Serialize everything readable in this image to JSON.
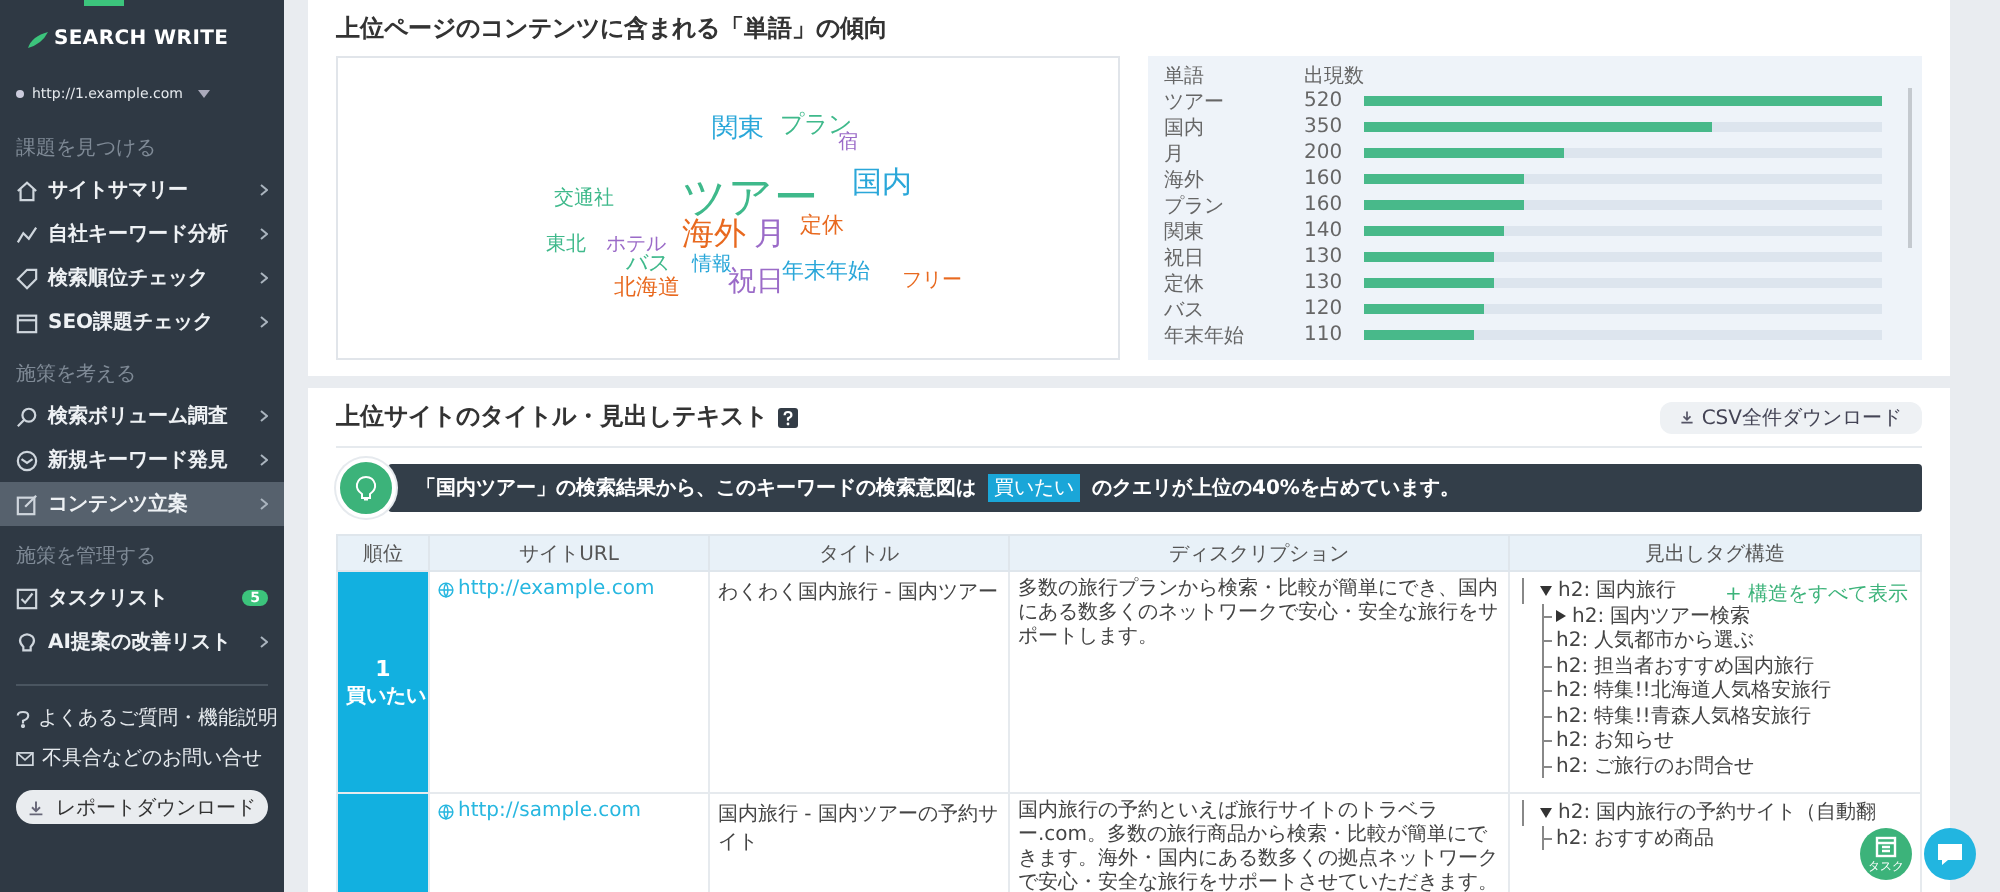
{
  "sidebar": {
    "logo": "SEARCH WRITE",
    "site": "http://1.example.com",
    "sections": [
      {
        "label": "課題を見つける",
        "items": [
          {
            "label": "サイトサマリー",
            "selected": false
          },
          {
            "label": "自社キーワード分析",
            "selected": false
          },
          {
            "label": "検索順位チェック",
            "selected": false
          },
          {
            "label": "SEO課題チェック",
            "selected": false
          }
        ]
      },
      {
        "label": "施策を考える",
        "items": [
          {
            "label": "検索ボリューム調査",
            "selected": false
          },
          {
            "label": "新規キーワード発見",
            "selected": false
          },
          {
            "label": "コンテンツ立案",
            "selected": true
          }
        ]
      },
      {
        "label": "施策を管理する",
        "items": [
          {
            "label": "タスクリスト",
            "selected": false,
            "badge": "5"
          },
          {
            "label": "AI提案の改善リスト",
            "selected": false
          }
        ]
      }
    ],
    "links": [
      "よくあるご質問・機能説明",
      "不具合などのお問い合せ"
    ],
    "report_button": "レポートダウンロード"
  },
  "word_section": {
    "title": "上位ページのコンテンツに含まれる「単語」の傾向",
    "words": [
      {
        "text": "関東",
        "color": "#2aa7d9"
      },
      {
        "text": "プラン",
        "color": "#3fb98b"
      },
      {
        "text": "宿",
        "color": "#9b6bc8"
      },
      {
        "text": "交通社",
        "color": "#3fb98b"
      },
      {
        "text": "ツアー",
        "color": "#3fb98b"
      },
      {
        "text": "国内",
        "color": "#2aa7d9"
      },
      {
        "text": "東北",
        "color": "#3fb98b"
      },
      {
        "text": "ホテル",
        "color": "#9b6bc8"
      },
      {
        "text": "海外",
        "color": "#e8691f"
      },
      {
        "text": "月",
        "color": "#9b6bc8"
      },
      {
        "text": "定休",
        "color": "#e8691f"
      },
      {
        "text": "バス",
        "color": "#3fb98b"
      },
      {
        "text": "情報",
        "color": "#2aa7d9"
      },
      {
        "text": "年末年始",
        "color": "#2aa7d9"
      },
      {
        "text": "北海道",
        "color": "#e8691f"
      },
      {
        "text": "祝日",
        "color": "#9b6bc8"
      },
      {
        "text": "フリー",
        "color": "#e8691f"
      }
    ],
    "frequency_table": {
      "columns": [
        "単語",
        "出現数"
      ],
      "rows": [
        {
          "word": "ツアー",
          "count": "520",
          "level": 1
        },
        {
          "word": "国内",
          "count": "350",
          "level": 0.673
        },
        {
          "word": "月",
          "count": "200",
          "level": 0.385
        },
        {
          "word": "海外",
          "count": "160",
          "level": 0.308
        },
        {
          "word": "プラン",
          "count": "160",
          "level": 0.308
        },
        {
          "word": "関東",
          "count": "140",
          "level": 0.269
        },
        {
          "word": "祝日",
          "count": "130",
          "level": 0.25
        },
        {
          "word": "定休",
          "count": "130",
          "level": 0.25
        },
        {
          "word": "バス",
          "count": "120",
          "level": 0.231
        },
        {
          "word": "年末年始",
          "count": "110",
          "level": 0.212
        }
      ]
    }
  },
  "headings_section": {
    "title": "上位サイトのタイトル・見出しテキスト",
    "csv_button": "CSV全件ダウンロード",
    "insight": {
      "before": "「国内ツアー」の検索結果から、このキーワードの検索意図は",
      "tag": "買いたい",
      "after": "のクエリが上位の40%を占めています。"
    },
    "table": {
      "columns": [
        "順位",
        "サイトURL",
        "タイトル",
        "ディスクリプション",
        "見出しタグ構造"
      ],
      "rows": [
        {
          "rank": "1",
          "intent": "買いたい",
          "url": "http://example.com",
          "title": "わくわく国内旅行 - 国内ツアー",
          "description": "多数の旅行プランから検索・比較が簡単にでき、国内にある数多くのネットワークで安心・安全な旅行をサポートします。",
          "show_all": "+ 構造をすべて表示",
          "headings": [
            {
              "text": "h2: 国内旅行",
              "kind": "group",
              "expanded": true,
              "children": [
                {
                  "text": "h2: 国内ツアー検索",
                  "kind": "group",
                  "expanded": false
                },
                {
                  "text": "h2: 人気都市から選ぶ",
                  "kind": "leaf"
                },
                {
                  "text": "h2: 担当者おすすめ国内旅行",
                  "kind": "leaf"
                },
                {
                  "text": "h2: 特集!!北海道人気格安旅行",
                  "kind": "leaf"
                },
                {
                  "text": "h2: 特集!!青森人気格安旅行",
                  "kind": "leaf"
                },
                {
                  "text": "h2: お知らせ",
                  "kind": "leaf"
                },
                {
                  "text": "h2: ご旅行のお問合せ",
                  "kind": "leaf"
                }
              ]
            }
          ]
        },
        {
          "url": "http://sample.com",
          "title": "国内旅行 - 国内ツアーの予約サイト",
          "description": "国内旅行の予約といえば旅行サイトのトラベラー.com。多数の旅行商品から検索・比較が簡単にできます。海外・国内にある数多くの拠点ネットワークで安心・安全な旅行をサポートさせていただきます。",
          "headings": [
            {
              "text": "h2: 国内旅行の予約サイト（自動翻",
              "kind": "group",
              "expanded": true,
              "children": [
                {
                  "text": "h2: おすすめ商品",
                  "kind": "leaf"
                }
              ]
            }
          ]
        }
      ]
    }
  },
  "task_button": "タスク"
}
